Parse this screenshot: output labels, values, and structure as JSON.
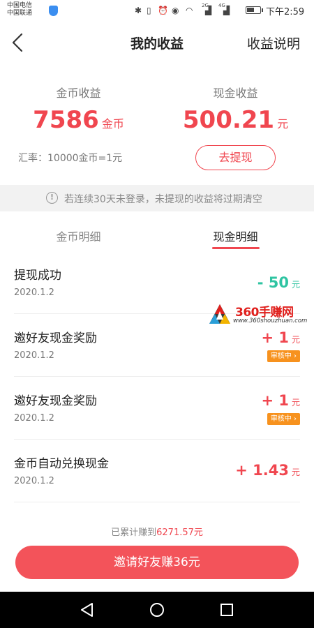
{
  "status_bar": {
    "carrier1": "中国电信",
    "carrier2": "中国联通",
    "net1": "2G",
    "net2": "4G",
    "time": "下午2:59",
    "battery_level": 0.65
  },
  "header": {
    "title": "我的收益",
    "right_link": "收益说明"
  },
  "earnings": {
    "coin": {
      "label": "金币收益",
      "amount": "7586",
      "unit": "金币"
    },
    "cash": {
      "label": "现金收益",
      "amount": "500.21",
      "unit": "元"
    },
    "rate": "汇率：10000金币=1元",
    "withdraw_button": "去提现"
  },
  "notice": {
    "icon_text": "!",
    "text": "若连续30天未登录，未提现的收益将过期清空"
  },
  "tabs": [
    {
      "label": "金币明细",
      "active": false
    },
    {
      "label": "现金明细",
      "active": true
    }
  ],
  "records": [
    {
      "title": "提现成功",
      "date": "2020.1.2",
      "amount": "- 50",
      "unit": "元"
    },
    {
      "title": "邀好友现金奖励",
      "date": "2020.1.2",
      "amount": "+ 1",
      "unit": "元",
      "badge": "审核中 ›"
    },
    {
      "title": "邀好友现金奖励",
      "date": "2020.1.2",
      "amount": "+ 1",
      "unit": "元",
      "badge": "审核中 ›"
    },
    {
      "title": "金币自动兑换现金",
      "date": "2020.1.2",
      "amount": "+ 1.43",
      "unit": "元"
    }
  ],
  "watermark": {
    "title": "360手赚网",
    "url": "www.360shouzhuan.com"
  },
  "footer": {
    "total_prefix": "已累计赚到",
    "total_value": "6271.57元",
    "invite_button": "邀请好友赚36元"
  },
  "colors": {
    "accent": "#f0464f",
    "withdraw_amount": "#2fc4a2",
    "badge": "#f7921e"
  },
  "icons": [
    "back-arrow-icon",
    "info-icon",
    "nav-back-icon",
    "nav-home-icon",
    "nav-recents-icon"
  ]
}
